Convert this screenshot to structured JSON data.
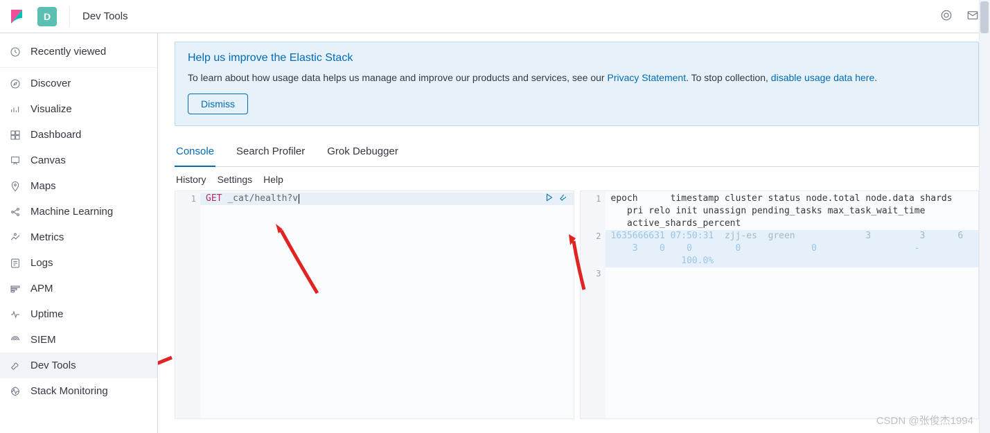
{
  "header": {
    "space_letter": "D",
    "breadcrumb": "Dev Tools"
  },
  "sidebar": {
    "items": [
      {
        "label": "Recently viewed",
        "icon": "clock"
      },
      {
        "label": "Discover",
        "icon": "compass"
      },
      {
        "label": "Visualize",
        "icon": "bars"
      },
      {
        "label": "Dashboard",
        "icon": "dashboard"
      },
      {
        "label": "Canvas",
        "icon": "canvas"
      },
      {
        "label": "Maps",
        "icon": "maps"
      },
      {
        "label": "Machine Learning",
        "icon": "ml"
      },
      {
        "label": "Metrics",
        "icon": "metrics"
      },
      {
        "label": "Logs",
        "icon": "logs"
      },
      {
        "label": "APM",
        "icon": "apm"
      },
      {
        "label": "Uptime",
        "icon": "uptime"
      },
      {
        "label": "SIEM",
        "icon": "siem"
      },
      {
        "label": "Dev Tools",
        "icon": "wrench",
        "selected": true
      },
      {
        "label": "Stack Monitoring",
        "icon": "monitor"
      }
    ]
  },
  "callout": {
    "title": "Help us improve the Elastic Stack",
    "text_before": "To learn about how usage data helps us manage and improve our products and services, see our ",
    "link1": "Privacy Statement",
    "text_middle": ". To stop collection, ",
    "link2": "disable usage data here",
    "text_after": ".",
    "dismiss": "Dismiss"
  },
  "tabs": {
    "items": [
      {
        "label": "Console",
        "active": true
      },
      {
        "label": "Search Profiler"
      },
      {
        "label": "Grok Debugger"
      }
    ]
  },
  "submenu": {
    "history": "History",
    "settings": "Settings",
    "help": "Help"
  },
  "console_input": {
    "line_number": "1",
    "method": "GET",
    "path": "_cat/health?v"
  },
  "console_output": {
    "lines": {
      "n1": "1",
      "n2": "2",
      "n3": "3"
    },
    "header_line": "epoch      timestamp cluster status node.total node.data shards\n   pri relo init unassign pending_tasks max_task_wait_time\n   active_shards_percent",
    "row_epoch": "1635666631",
    "row_time": "07:50:31",
    "row_rest1": "  zjj-es  green             3         3      6",
    "row_rest2": "    3    0    0        0             0                  -",
    "row_rest3": "             100.0%"
  },
  "watermark": "CSDN @张俊杰1994"
}
